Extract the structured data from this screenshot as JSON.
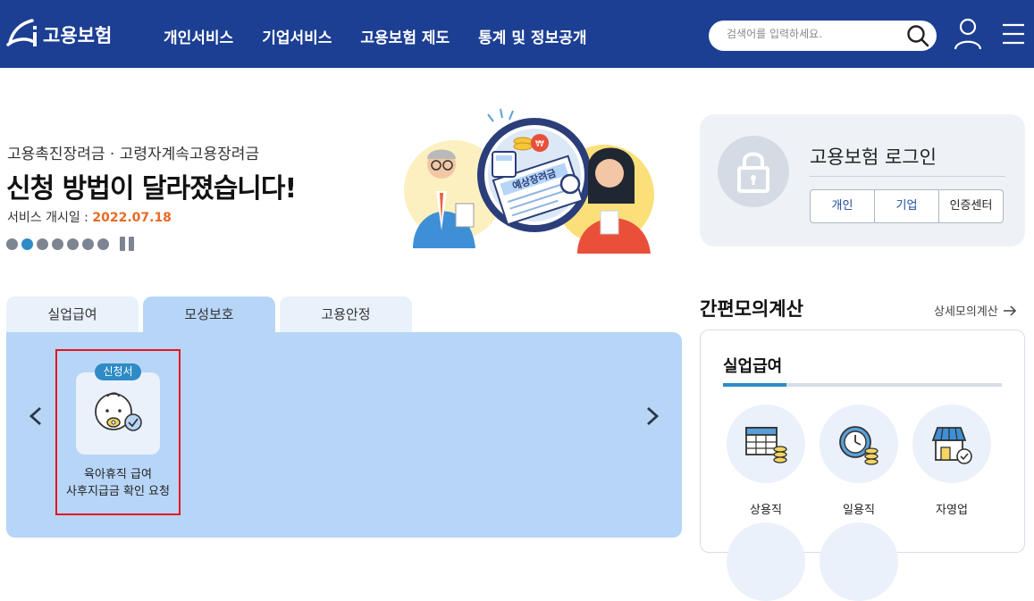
{
  "header": {
    "logo_text": "고용보험",
    "nav": [
      "개인서비스",
      "기업서비스",
      "고용보험 제도",
      "통계 및 정보공개"
    ],
    "search_placeholder": "검색어를 입력하세요."
  },
  "banner": {
    "subtitle": "고용촉진장려금 · 고령자계속고용장려금",
    "title": "신청 방법이 달라졌습니다!",
    "date_label": "서비스 개시일 : ",
    "date_value": "2022.07.18",
    "illustration_text": "예상장려금",
    "dot_count": 7,
    "active_dot": 1
  },
  "login": {
    "title": "고용보험 로그인",
    "buttons": [
      "개인",
      "기업",
      "인증센터"
    ]
  },
  "service_tabs": {
    "tabs": [
      "실업급여",
      "모성보호",
      "고용안정"
    ],
    "active_tab": 1,
    "card": {
      "badge": "신청서",
      "label_line1": "육아휴직 급여",
      "label_line2": "사후지급금 확인 요청"
    }
  },
  "calculator": {
    "title": "간편모의계산",
    "more_link": "상세모의계산",
    "subtitle": "실업급여",
    "items": [
      "상용직",
      "일용직",
      "자영업"
    ]
  },
  "colors": {
    "header_bg": "#1c3f94",
    "accent_blue": "#2e8bc6",
    "date_orange": "#e86a26",
    "panel_blue": "#b7d5f7",
    "highlight_red": "#e8101a"
  }
}
